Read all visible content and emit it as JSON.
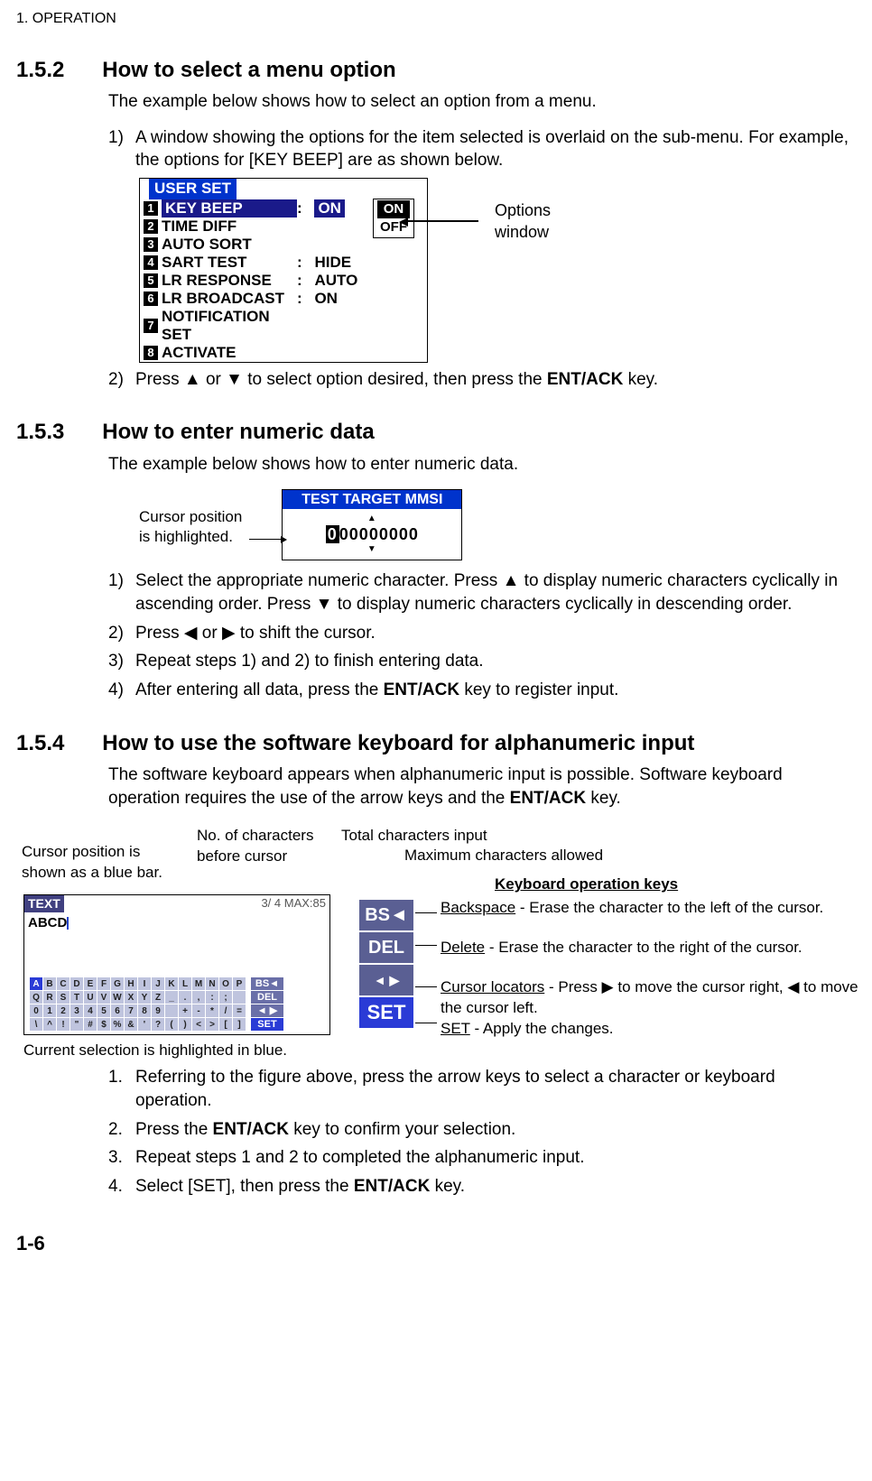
{
  "header": {
    "chapter": "1.  OPERATION"
  },
  "sec152": {
    "num": "1.5.2",
    "title": "How to select a menu option",
    "intro": "The example below shows how to select an option from a menu.",
    "step1_marker": "1)",
    "step1_text": "A window showing the options for the item selected is overlaid on the sub-menu. For example, the options for [KEY BEEP] are as shown below.",
    "menu": {
      "title": "USER SET",
      "rows": [
        {
          "n": "1",
          "label": "KEY BEEP",
          "val": "ON",
          "hi": true
        },
        {
          "n": "2",
          "label": "TIME DIFF",
          "val": ""
        },
        {
          "n": "3",
          "label": "AUTO SORT",
          "val": ""
        },
        {
          "n": "4",
          "label": "SART TEST",
          "val": "HIDE"
        },
        {
          "n": "5",
          "label": "LR RESPONSE",
          "val": "AUTO"
        },
        {
          "n": "6",
          "label": "LR BROADCAST",
          "val": "ON"
        },
        {
          "n": "7",
          "label": "NOTIFICATION SET",
          "val": ""
        },
        {
          "n": "8",
          "label": "ACTIVATE",
          "val": ""
        }
      ],
      "popup": {
        "on": "ON",
        "off": "OFF"
      },
      "callout1": "Options",
      "callout2": "window"
    },
    "step2_marker": "2)",
    "step2_a": "Press ",
    "step2_b": " or ",
    "step2_c": " to select option desired, then press the ",
    "step2_key": "ENT/ACK",
    "step2_d": " key.",
    "up": "▲",
    "down": "▼"
  },
  "sec153": {
    "num": "1.5.3",
    "title": "How to enter numeric data",
    "intro": "The example below shows how to enter numeric data.",
    "caption1": "Cursor position",
    "caption2": "is highlighted.",
    "mmsi_title": "TEST TARGET MMSI",
    "mmsi_cur": "0",
    "mmsi_rest": "00000000",
    "s1m": "1)",
    "s1": "Select the appropriate numeric character. Press ▲ to display numeric characters cyclically in ascending order. Press ▼ to display numeric characters cyclically in descending order.",
    "s2m": "2)",
    "s2a": "Press ",
    "s2b": " or ",
    "s2c": " to shift the cursor.",
    "left": "◀",
    "right": "▶",
    "s3m": "3)",
    "s3": "Repeat steps 1) and 2) to finish entering data.",
    "s4m": "4)",
    "s4a": "After entering all data, press the ",
    "s4key": "ENT/ACK",
    "s4b": " key to register input."
  },
  "sec154": {
    "num": "1.5.4",
    "title": "How to use the software keyboard for alphanumeric input",
    "intro_a": "The software keyboard appears when alphanumeric input is possible. Software keyboard operation requires the use of the arrow keys and the ",
    "intro_key": "ENT/ACK",
    "intro_b": " key.",
    "annot": {
      "cursor_shown": "Cursor position is\nshown as a blue bar.",
      "before": "No. of characters\nbefore cursor",
      "total": "Total characters input",
      "max": "Maximum characters allowed",
      "kops": "Keyboard operation keys",
      "bs_u": "Backspace",
      "bs": " - Erase the character to the left of the cursor.",
      "del_u": "Delete",
      "del": " - Erase the character to the right of the cursor.",
      "loc_u": "Cursor locators",
      "loc": " - Press ▶ to move the cursor right, ◀ to move the cursor left.",
      "set_u": "SET",
      "set": " - Apply the changes.",
      "current": "Current selection is highlighted in blue."
    },
    "screen": {
      "title": "TEXT",
      "info": "3/  4  MAX:85",
      "typed": "ABCD",
      "bs": "BS◄",
      "del": "DEL",
      "loc": "◄ ▶",
      "set": "SET",
      "big_bs": "BS◄",
      "big_del": "DEL",
      "big_loc": "◄  ▶",
      "big_set": "SET",
      "row1": [
        "A",
        "B",
        "C",
        "D",
        "E",
        "F",
        "G",
        "H",
        "I",
        "J",
        "K",
        "L",
        "M",
        "N",
        "O",
        "P"
      ],
      "row2": [
        "Q",
        "R",
        "S",
        "T",
        "U",
        "V",
        "W",
        "X",
        "Y",
        "Z",
        "_",
        ".",
        ",",
        ":",
        ";",
        " "
      ],
      "row3": [
        "0",
        "1",
        "2",
        "3",
        "4",
        "5",
        "6",
        "7",
        "8",
        "9",
        " ",
        "+",
        "-",
        "*",
        "/",
        "="
      ],
      "row4": [
        "\\",
        "^",
        "!",
        "\"",
        "#",
        "$",
        "%",
        "&",
        "'",
        "?",
        "(",
        ")",
        "<",
        ">",
        "[",
        "]"
      ]
    },
    "s1m": "1.",
    "s1": "Referring to the figure above, press the arrow keys to select a character or keyboard operation.",
    "s2m": "2.",
    "s2a": "Press the ",
    "s2key": "ENT/ACK",
    "s2b": " key to confirm your selection.",
    "s3m": "3.",
    "s3": "Repeat steps 1 and 2 to completed the alphanumeric input.",
    "s4m": "4.",
    "s4a": "Select [SET], then press the ",
    "s4key": "ENT/ACK",
    "s4b": " key."
  },
  "pagenum": "1-6"
}
